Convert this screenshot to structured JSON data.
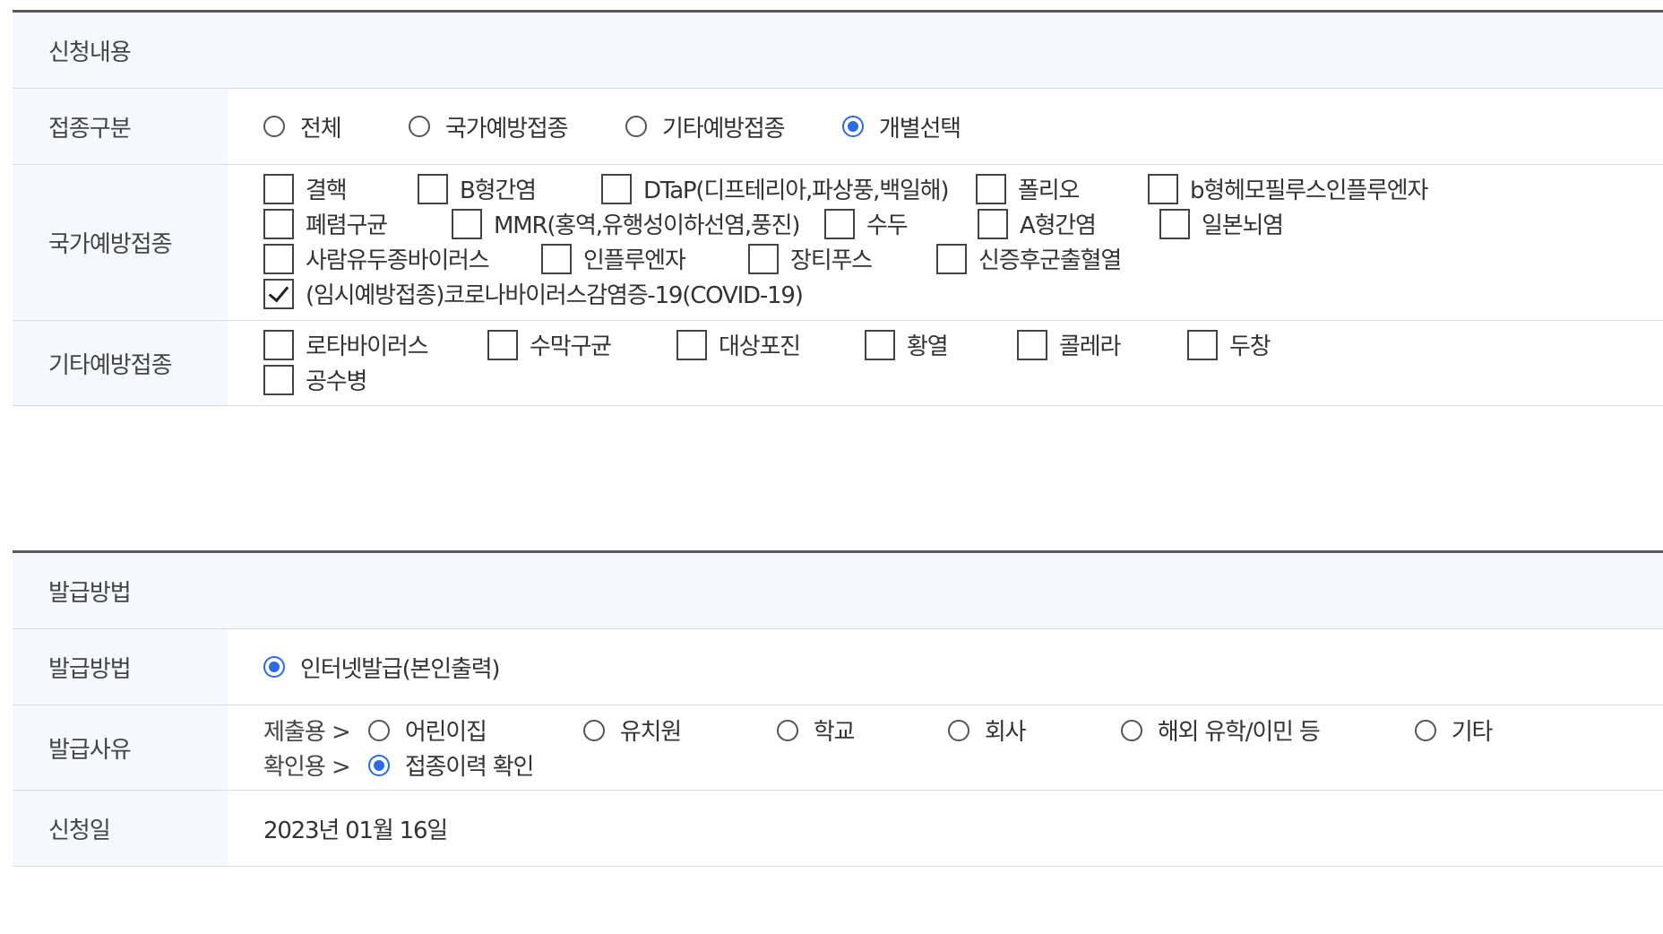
{
  "section1": {
    "title": "신청내용",
    "vacc_type": {
      "label": "접종구분",
      "options": [
        {
          "label": "전체",
          "checked": false
        },
        {
          "label": "국가예방접종",
          "checked": false
        },
        {
          "label": "기타예방접종",
          "checked": false
        },
        {
          "label": "개별선택",
          "checked": true
        }
      ]
    },
    "national": {
      "label": "국가예방접종",
      "rows": [
        [
          {
            "label": "결핵",
            "checked": false
          },
          {
            "label": "B형간염",
            "checked": false
          },
          {
            "label": "DTaP(디프테리아,파상풍,백일해)",
            "checked": false
          },
          {
            "label": "폴리오",
            "checked": false
          },
          {
            "label": "b형헤모필루스인플루엔자",
            "checked": false
          }
        ],
        [
          {
            "label": "폐렴구균",
            "checked": false
          },
          {
            "label": "MMR(홍역,유행성이하선염,풍진)",
            "checked": false
          },
          {
            "label": "수두",
            "checked": false
          },
          {
            "label": "A형간염",
            "checked": false
          },
          {
            "label": "일본뇌염",
            "checked": false
          }
        ],
        [
          {
            "label": "사람유두종바이러스",
            "checked": false
          },
          {
            "label": "인플루엔자",
            "checked": false
          },
          {
            "label": "장티푸스",
            "checked": false
          },
          {
            "label": "신증후군출혈열",
            "checked": false
          }
        ],
        [
          {
            "label": "(임시예방접종)코로나바이러스감염증-19(COVID-19)",
            "checked": true
          }
        ]
      ]
    },
    "other": {
      "label": "기타예방접종",
      "rows": [
        [
          {
            "label": "로타바이러스",
            "checked": false
          },
          {
            "label": "수막구균",
            "checked": false
          },
          {
            "label": "대상포진",
            "checked": false
          },
          {
            "label": "황열",
            "checked": false
          },
          {
            "label": "콜레라",
            "checked": false
          },
          {
            "label": "두창",
            "checked": false
          }
        ],
        [
          {
            "label": "공수병",
            "checked": false
          }
        ]
      ]
    }
  },
  "section2": {
    "title": "발급방법",
    "method": {
      "label": "발급방법",
      "option": {
        "label": "인터넷발급(본인출력)",
        "checked": true
      }
    },
    "reason": {
      "label": "발급사유",
      "submit_label": "제출용 >",
      "submit_options": [
        {
          "label": "어린이집",
          "checked": false
        },
        {
          "label": "유치원",
          "checked": false
        },
        {
          "label": "학교",
          "checked": false
        },
        {
          "label": "회사",
          "checked": false
        },
        {
          "label": "해외 유학/이민 등",
          "checked": false
        },
        {
          "label": "기타",
          "checked": false
        }
      ],
      "confirm_label": "확인용 >",
      "confirm_option": {
        "label": "접종이력 확인",
        "checked": true
      }
    },
    "date": {
      "label": "신청일",
      "value": "2023년 01월 16일"
    }
  },
  "colors": {
    "accent": "#2d6be4",
    "header_bg": "#f5f8fc",
    "border": "#d8dde3"
  }
}
